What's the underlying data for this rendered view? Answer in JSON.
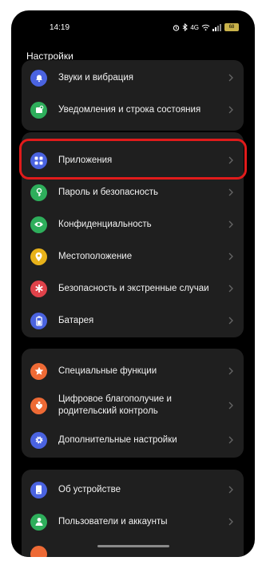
{
  "status_bar": {
    "time": "14:19",
    "network": "4G",
    "battery": "68"
  },
  "header": {
    "title": "Настройки"
  },
  "cards": [
    {
      "items": [
        {
          "label": "Звуки и вибрация",
          "icon": "bell-icon",
          "color": "#4a63e0"
        },
        {
          "label": "Уведомления и строка состояния",
          "icon": "notification-icon",
          "color": "#2eae5b"
        }
      ]
    },
    {
      "items": [
        {
          "label": "Приложения",
          "icon": "apps-grid-icon",
          "color": "#4a63e0"
        },
        {
          "label": "Пароль и безопасность",
          "icon": "key-icon",
          "color": "#2eae5b"
        },
        {
          "label": "Конфиденциальность",
          "icon": "eye-icon",
          "color": "#2eae5b"
        },
        {
          "label": "Местоположение",
          "icon": "location-icon",
          "color": "#e8b21a"
        },
        {
          "label": "Безопасность и экстренные случаи",
          "icon": "emergency-icon",
          "color": "#e0424a"
        },
        {
          "label": "Батарея",
          "icon": "battery-icon",
          "color": "#4a63e0"
        }
      ]
    },
    {
      "items": [
        {
          "label": "Специальные функции",
          "icon": "star-icon",
          "color": "#ee6a35"
        },
        {
          "label": "Цифровое благополучие и родительский контроль",
          "icon": "wellbeing-icon",
          "color": "#ee6a35"
        },
        {
          "label": "Дополнительные настройки",
          "icon": "gear-icon",
          "color": "#4a63e0"
        }
      ]
    },
    {
      "items": [
        {
          "label": "Об устройстве",
          "icon": "phone-icon",
          "color": "#4a63e0"
        },
        {
          "label": "Пользователи и аккаунты",
          "icon": "user-icon",
          "color": "#2eae5b"
        }
      ]
    }
  ],
  "highlight_color": "#e01b1b"
}
